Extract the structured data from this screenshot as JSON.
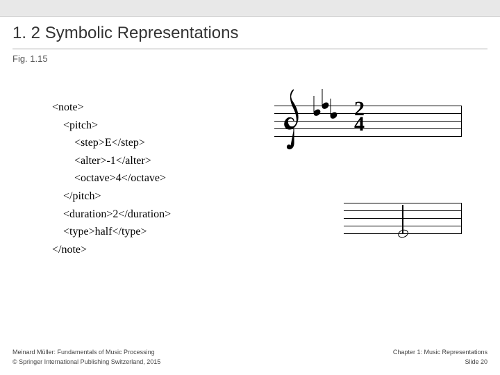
{
  "title": "1. 2 Symbolic Representations",
  "figure_label": "Fig. 1.15",
  "xml_lines": [
    "<note>",
    "    <pitch>",
    "        <step>E</step>",
    "        <alter>-1</alter>",
    "        <octave>4</octave>",
    "    </pitch>",
    "    <duration>2</duration>",
    "    <type>half</type>",
    "</note>"
  ],
  "time_signature": {
    "num": "2",
    "den": "4"
  },
  "footer": {
    "author": "Meinard Müller: Fundamentals of Music Processing",
    "chapter": "Chapter 1: Music Representations",
    "copyright": "© Springer International Publishing Switzerland, 2015",
    "slide": "Slide 20"
  }
}
